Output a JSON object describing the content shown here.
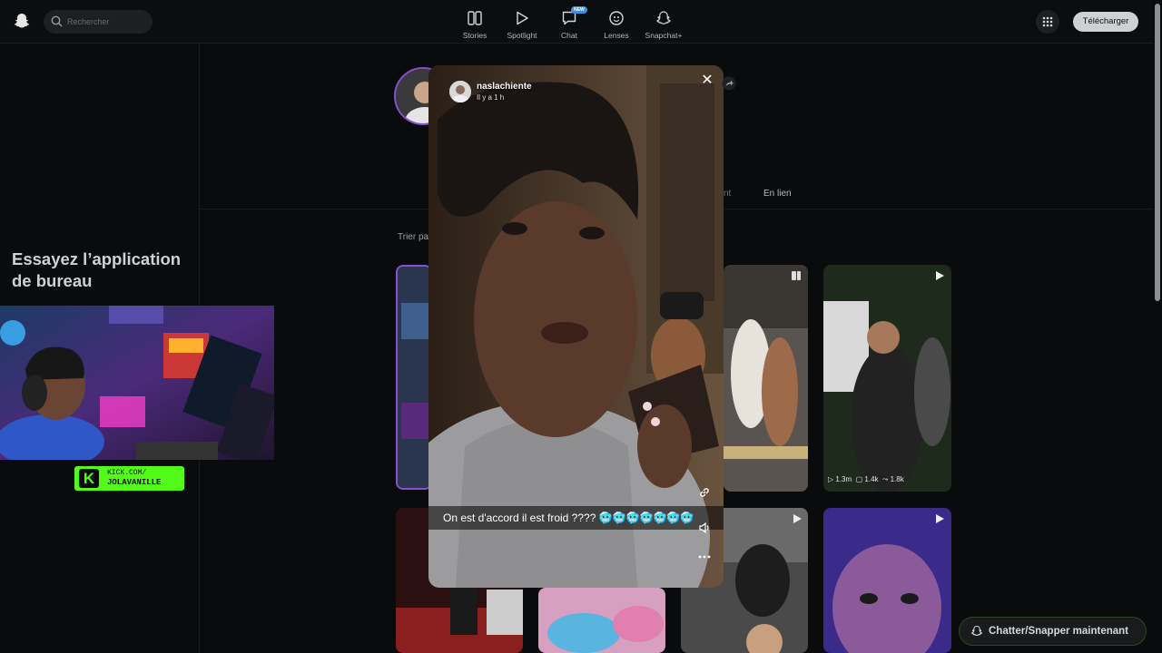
{
  "header": {
    "search_placeholder": "Rechercher",
    "nav": [
      {
        "label": "Stories",
        "icon": "stories-icon"
      },
      {
        "label": "Spotlight",
        "icon": "spotlight-play-icon"
      },
      {
        "label": "Chat",
        "icon": "chat-icon",
        "badge": "NEW"
      },
      {
        "label": "Lenses",
        "icon": "lenses-icon"
      },
      {
        "label": "Snapchat+",
        "icon": "snapchat-plus-icon"
      }
    ],
    "download_label": "Télécharger"
  },
  "sidebar": {
    "promo_title": "Essayez l’application de bureau"
  },
  "stream_overlay": {
    "kick_line1": "KICK.COM/",
    "kick_line2": "JOLAVANILLE"
  },
  "profile": {
    "tab_partial": "nt",
    "tab_linked": "En lien",
    "sort_label": "Trier pa"
  },
  "grid": [
    {
      "stats": {
        "views": "1.3m",
        "comments": "1.4k",
        "shares": "1.8k"
      }
    }
  ],
  "story": {
    "username": "naslachiente",
    "time": "Il y a 1 h",
    "caption": "On est d'accord il est froid ???? 🥶🥶🥶🥶🥶🥶🥶"
  },
  "chat_now_label": "Chatter/Snapper maintenant",
  "colors": {
    "accent_purple": "#8a4fd0",
    "kick_green": "#53fc18"
  }
}
